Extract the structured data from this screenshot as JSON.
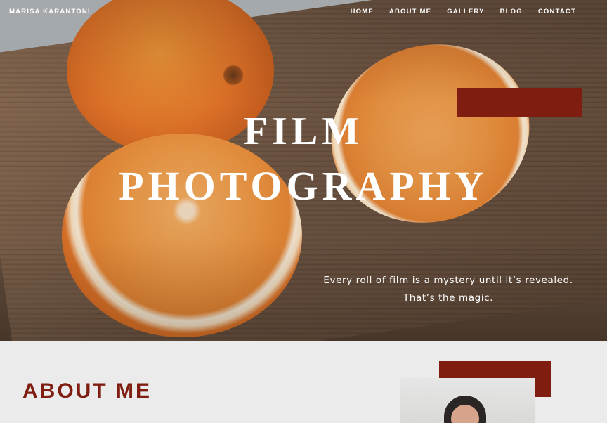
{
  "site": {
    "name": "MARISA KARANTONI"
  },
  "nav": {
    "items": [
      "HOME",
      "ABOUT ME",
      "GALLERY",
      "BLOG",
      "CONTACT"
    ]
  },
  "hero": {
    "title_line1": "FILM",
    "title_line2": "PHOTOGRAPHY",
    "tagline_line1": "Every roll of film is a mystery until it’s revealed.",
    "tagline_line2": "That’s the magic."
  },
  "about": {
    "heading": "ABOUT ME"
  },
  "colors": {
    "accent": "#7e1d10",
    "background": "#ebebeb",
    "nav_text": "#ffffff"
  }
}
